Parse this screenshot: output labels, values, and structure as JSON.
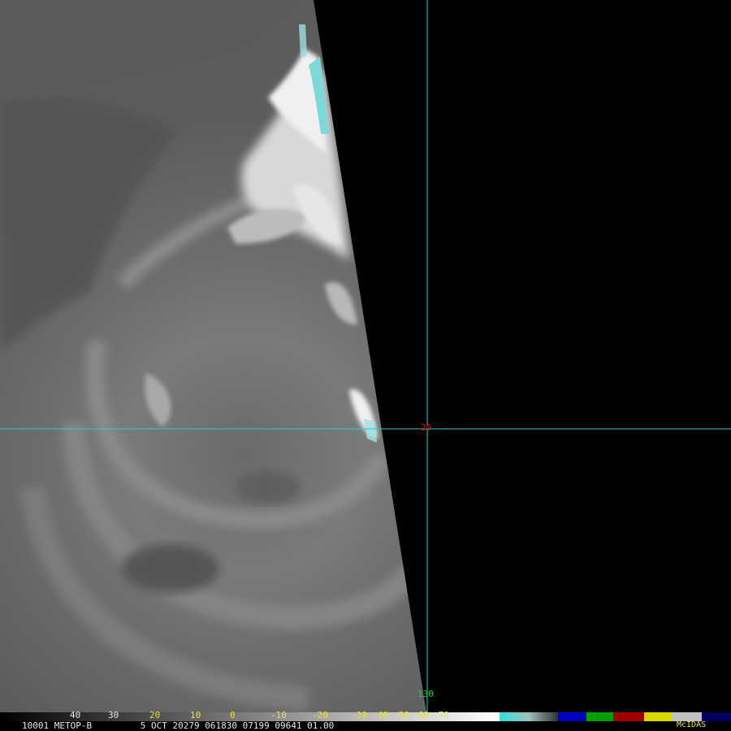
{
  "header_info": {
    "station_id": "10001",
    "satellite": "METOP-B",
    "date": "5 OCT 20279",
    "time": "061830",
    "orbit": "07199",
    "band": "09641",
    "scale": "01.00"
  },
  "gridlines": {
    "lat_label": "20",
    "lon_label": "130",
    "line_color": "#20d0d0",
    "lat_label_color": "#e01010",
    "lon_label_color": "#20d020"
  },
  "colorbar": {
    "tick_labels": [
      "40",
      "30",
      "20",
      "10",
      "0",
      "-10",
      "-20",
      "-30",
      "-40",
      "-50",
      "-60",
      "-70"
    ],
    "tick_colors": [
      "#e8e8e8",
      "#e8e8e8",
      "#e8e040",
      "#e8e040",
      "#e8e040",
      "#e8e040",
      "#e8e040",
      "#e8e040",
      "#e8e040",
      "#e8e040",
      "#e8e040",
      "#e8e040"
    ],
    "brand": "McIDAS",
    "brand_color": "#e8e040",
    "segment_colors": {
      "cyan": "#20c8c8",
      "blue": "#0000c0",
      "green": "#00a000",
      "red": "#a00000",
      "yellow": "#d8d800",
      "navy": "#000060"
    }
  }
}
